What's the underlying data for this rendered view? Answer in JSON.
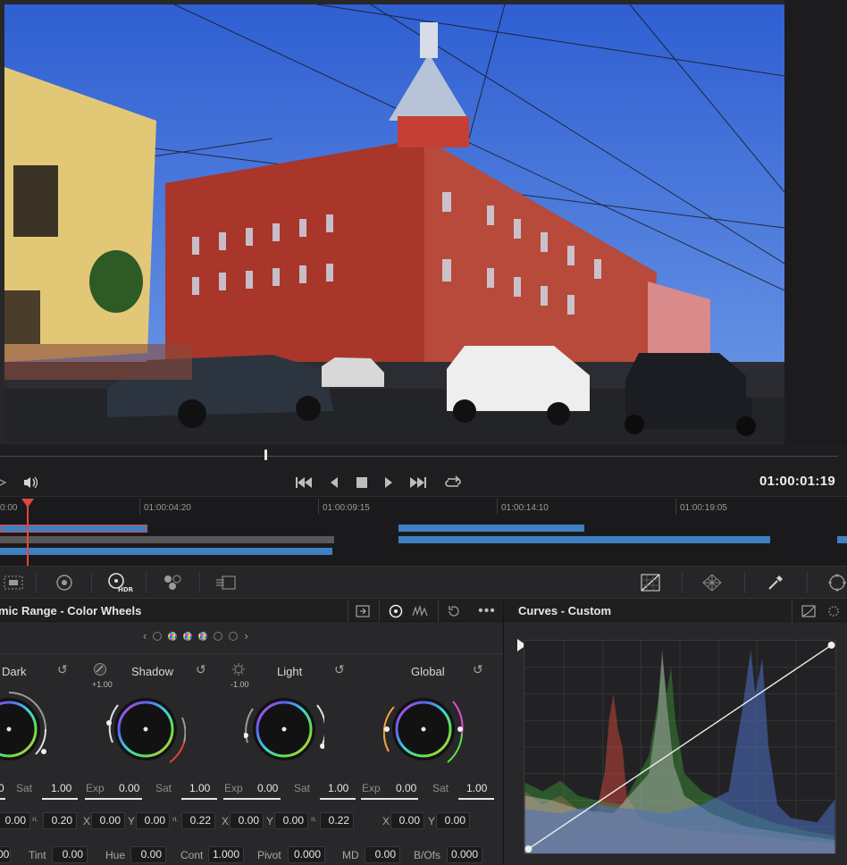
{
  "transport": {
    "timecode": "01:00:01:19",
    "buttons": [
      "layers-icon",
      "volume-icon",
      "skip-back-icon",
      "step-back-icon",
      "stop-icon",
      "play-icon",
      "skip-forward-icon",
      "loop-icon"
    ]
  },
  "timeline": {
    "ruler": [
      "0:00",
      "01:00:04:20",
      "01:00:09:15",
      "01:00:14:10",
      "01:00:19:05"
    ]
  },
  "wheels": {
    "title": "mic Range - Color Wheels",
    "items": [
      {
        "name": "Dark",
        "knob_value": ""
      },
      {
        "name": "Shadow",
        "knob_value": "+1.00"
      },
      {
        "name": "Light",
        "knob_value": "-1.00"
      },
      {
        "name": "Global",
        "knob_value": ""
      }
    ],
    "params": {
      "dark": {
        "sat_label": "Sat",
        "sat_value": "1.00",
        "exp_value": "0"
      },
      "shadow": {
        "exp_label": "Exp",
        "exp_value": "0.00",
        "sat_label": "Sat",
        "sat_value": "1.00"
      },
      "light": {
        "exp_label": "Exp",
        "exp_value": "0.00",
        "sat_label": "Sat",
        "sat_value": "1.00"
      },
      "global": {
        "exp_label": "Exp",
        "exp_value": "0.00",
        "sat_label": "Sat",
        "sat_value": "1.00"
      }
    },
    "xy": {
      "dark": {
        "x": "0.00",
        "val": "0.20"
      },
      "shadow": {
        "x_label": "X",
        "x": "0.00",
        "y_label": "Y",
        "y": "0.00",
        "val": "0.22"
      },
      "light": {
        "x_label": "X",
        "x": "0.00",
        "y_label": "Y",
        "y": "0.00",
        "val": "0.22"
      },
      "global": {
        "x_label": "X",
        "x": "0.00",
        "y_label": "Y",
        "y": "0.00"
      }
    },
    "bottom": {
      "first_value": "0.00",
      "tint_label": "Tint",
      "tint": "0.00",
      "hue_label": "Hue",
      "hue": "0.00",
      "cont_label": "Cont",
      "cont": "1.000",
      "pivot_label": "Pivot",
      "pivot": "0.000",
      "md_label": "MD",
      "md": "0.00",
      "bofs_label": "B/Ofs",
      "bofs": "0.000"
    }
  },
  "curves": {
    "title": "Curves - Custom"
  },
  "colors": {
    "accent_red": "#e2473d",
    "clip_blue": "#3f7fc4",
    "panel_bg": "#28282a"
  }
}
